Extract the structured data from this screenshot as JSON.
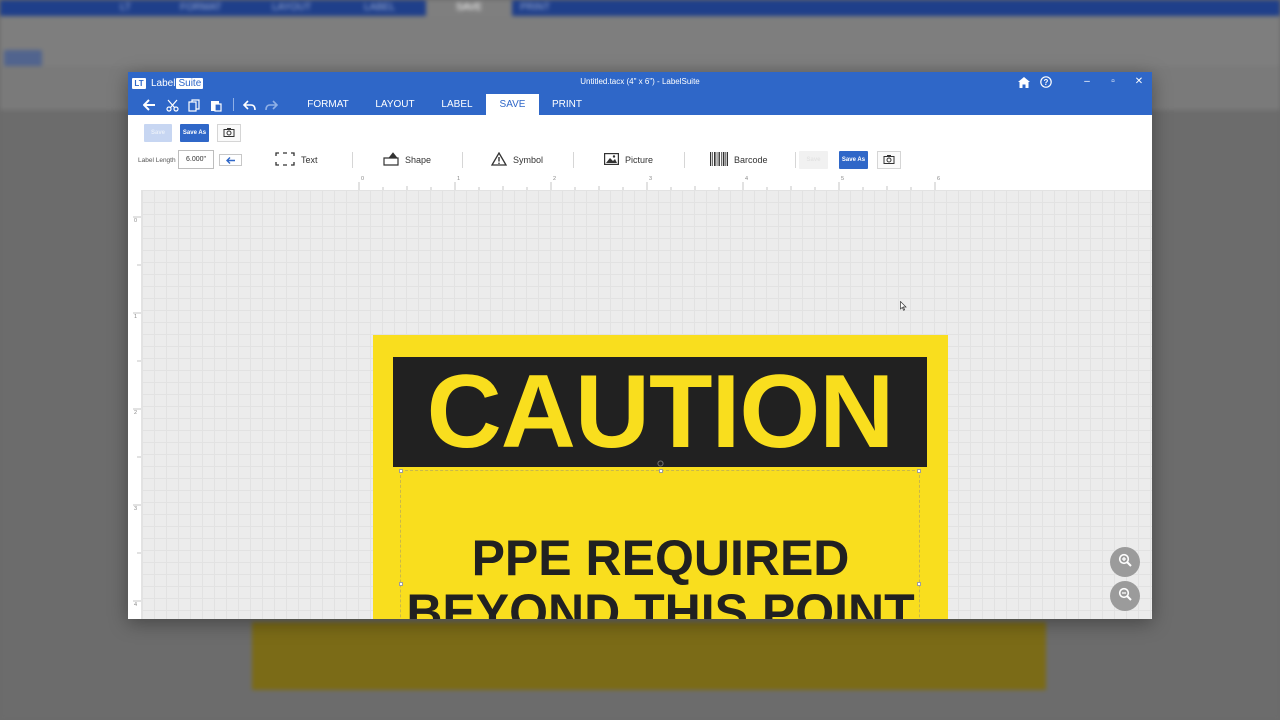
{
  "background_app": {
    "tabs": [
      "LT",
      "FORMAT",
      "LAYOUT",
      "LABEL",
      "SAVE",
      "PRINT"
    ]
  },
  "window": {
    "title": "Untitled.tacx (4\" x 6\") - LabelSuite",
    "logo_mark": "LT",
    "logo_label": "Label",
    "logo_label_suite": "Suite",
    "controls": {
      "minimize": "–",
      "restore": "▫",
      "close": "✕"
    }
  },
  "menubar": {
    "tabs": [
      {
        "label": "FORMAT",
        "active": false
      },
      {
        "label": "LAYOUT",
        "active": false
      },
      {
        "label": "LABEL",
        "active": false
      },
      {
        "label": "SAVE",
        "active": true
      },
      {
        "label": "PRINT",
        "active": false
      }
    ]
  },
  "toolbar": {
    "save_button": "Save",
    "save_as_button": "Save As",
    "label_length_label": "Label Length",
    "label_length_value": "6.000\"",
    "tools": [
      {
        "label": "Text",
        "icon": "text-frame-icon"
      },
      {
        "label": "Shape",
        "icon": "shape-icon"
      },
      {
        "label": "Symbol",
        "icon": "warning-triangle-icon"
      },
      {
        "label": "Picture",
        "icon": "picture-icon"
      },
      {
        "label": "Barcode",
        "icon": "barcode-icon"
      }
    ],
    "right_save_button": "Save",
    "right_save_as_button": "Save As"
  },
  "rulers": {
    "top": [
      "0",
      "1",
      "2",
      "3",
      "4",
      "5",
      "6"
    ],
    "left": [
      "0",
      "1",
      "2",
      "3",
      "4"
    ]
  },
  "label": {
    "header_text": "CAUTION",
    "body_line1": "PPE REQUIRED",
    "body_line2": "BEYOND THIS POINT",
    "colors": {
      "background": "#f9de1e",
      "header_band": "#212121",
      "text": "#212121"
    }
  },
  "zoom": {
    "in": "zoom-in-icon",
    "out": "zoom-out-icon"
  },
  "colors": {
    "accent": "#2f67c8",
    "button": "#2f67c8"
  }
}
